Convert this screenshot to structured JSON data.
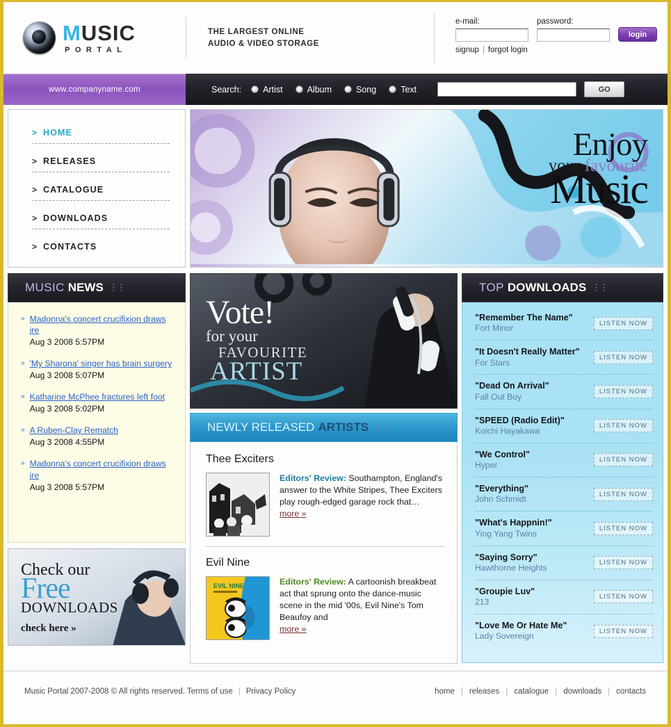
{
  "brand": {
    "logo_music": "MUSIC",
    "logo_m": "M",
    "logo_rest": "USIC",
    "logo_portal": "PORTAL",
    "tagline_line1": "THE LARGEST ONLINE",
    "tagline_line2": "AUDIO & VIDEO STORAGE",
    "accent_purple": "#8b53bd",
    "accent_cyan": "#2aa8c9",
    "border_gold": "#d9b92b"
  },
  "login": {
    "email_label": "e-mail:",
    "email_value": "",
    "password_label": "password:",
    "password_value": "",
    "login_button": "login",
    "signup_link": "signup",
    "forgot_link": "forgot login",
    "separator": "|"
  },
  "searchbar": {
    "url": "www.companyname.com",
    "label": "Search:",
    "options": [
      "Artist",
      "Album",
      "Song",
      "Text"
    ],
    "input_value": "",
    "go_button": "GO"
  },
  "nav": {
    "arrow": ">",
    "items": [
      {
        "label": "HOME",
        "active": true
      },
      {
        "label": "RELEASES",
        "active": false
      },
      {
        "label": "CATALOGUE",
        "active": false
      },
      {
        "label": "DOWNLOADS",
        "active": false
      },
      {
        "label": "CONTACTS",
        "active": false
      }
    ]
  },
  "hero": {
    "line1": "Enjoy",
    "line2_a": "your ",
    "line2_b": "favourite",
    "line3": "Music"
  },
  "news": {
    "title_1": "MUSIC",
    "title_2": "NEWS",
    "bullet": "»",
    "items": [
      {
        "headline": "Madonna's concert crucifixion draws ire",
        "date": "Aug 3 2008 5:57PM"
      },
      {
        "headline": "'My Sharona' singer has brain surgery",
        "date": "Aug 3 2008 5:07PM"
      },
      {
        "headline": "Katharine McPhee fractures left foot",
        "date": "Aug 3 2008 5:02PM"
      },
      {
        "headline": "A Ruben-Clay Rematch",
        "date": "Aug 3 2008 4:55PM"
      },
      {
        "headline": "Madonna's concert crucifixion draws ire",
        "date": "Aug 3 2008 5:57PM"
      }
    ]
  },
  "promo": {
    "line1": "Check our",
    "line2": "Free",
    "line3": "DOWNLOADS",
    "cta": "check here »"
  },
  "vote": {
    "line1": "Vote!",
    "line2": "for your",
    "line3": "FAVOURITE",
    "line4": "ARTIST"
  },
  "newly_released": {
    "title_1": "NEWLY RELEASED",
    "title_2": "ARTISTS",
    "artists": [
      {
        "name": "Thee Exciters",
        "review_label": "Editors' Review:",
        "review_text": " Southampton, England's answer to the White Stripes, Thee Exciters play rough-edged garage rock that…",
        "more": "more »"
      },
      {
        "name": "Evil Nine",
        "review_label": "Editors' Review:",
        "review_text": "  A cartoonish breakbeat act that sprung onto the dance-music scene in the mid '00s, Evil Nine's Tom Beaufoy and",
        "more": "more »"
      }
    ]
  },
  "top_downloads": {
    "title_1": "TOP",
    "title_2": "DOWNLOADS",
    "button_label": "listen now",
    "items": [
      {
        "title": "\"Remember The Name\"",
        "artist": "Fort Minor"
      },
      {
        "title": "\"It Doesn't Really Matter\"",
        "artist": "For Stars"
      },
      {
        "title": "\"Dead On Arrival\"",
        "artist": "Fall Out Boy"
      },
      {
        "title": "\"SPEED (Radio Edit)\"",
        "artist": "Koichi Hayakawa"
      },
      {
        "title": "\"We Control\"",
        "artist": "Hyper"
      },
      {
        "title": "\"Everything\"",
        "artist": "John Schmidt"
      },
      {
        "title": "\"What's Happnin!\"",
        "artist": "Ying Yang Twins"
      },
      {
        "title": "\"Saying Sorry\"",
        "artist": "Hawthorne Heights"
      },
      {
        "title": "\"Groupie Luv\"",
        "artist": "213"
      },
      {
        "title": "\"Love Me Or Hate Me\"",
        "artist": "Lady Sovereign"
      }
    ]
  },
  "footer": {
    "copyright": "Music Portal 2007-2008 © All rights reserved. Terms of use",
    "privacy": "Privacy Policy",
    "separator": "|",
    "links": [
      "home",
      "releases",
      "catalogue",
      "downloads",
      "contacts"
    ]
  }
}
